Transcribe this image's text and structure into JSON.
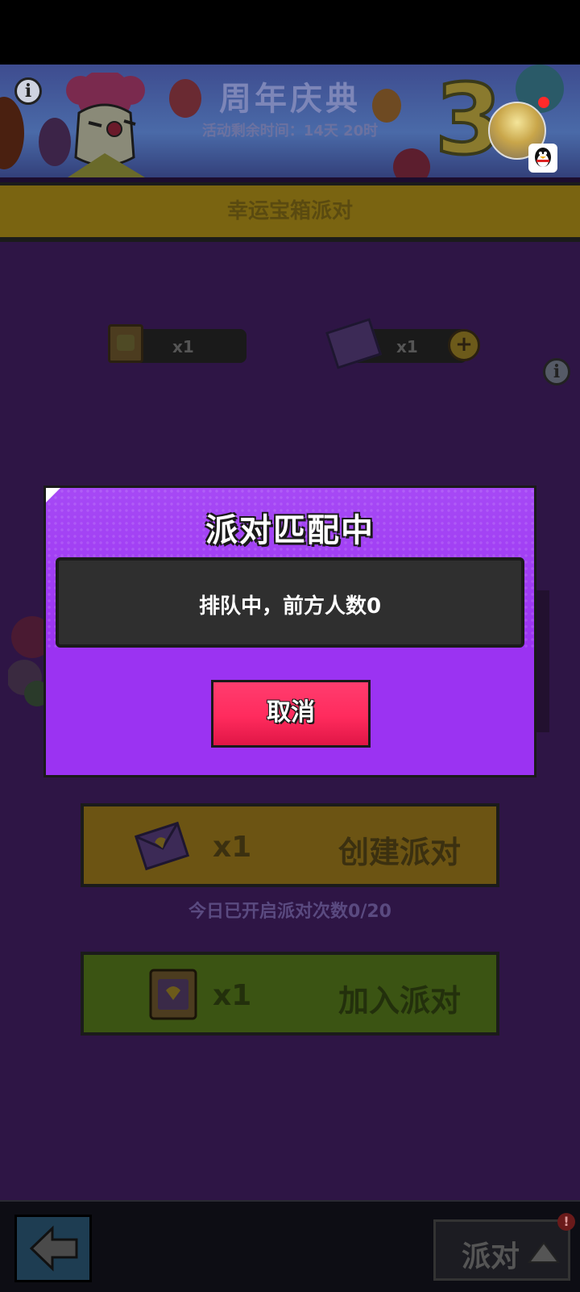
{
  "banner": {
    "title": "周年庆典",
    "subtitle": "活动剩余时间：14天 20时",
    "anniversary_number": "3"
  },
  "section": {
    "title": "幸运宝箱派对"
  },
  "resources": {
    "ticket_count": "x1",
    "envelope_count": "x1"
  },
  "modal": {
    "title": "派对匹配中",
    "message": "排队中，前方人数0",
    "cancel_label": "取消"
  },
  "actions": {
    "create_count": "x1",
    "create_label": "创建派对",
    "today_status": "今日已开启派对次数0/20",
    "join_count": "x1",
    "join_label": "加入派对"
  },
  "bottom": {
    "party_label": "派对",
    "alert": "!"
  },
  "icons": {
    "info": "info-icon",
    "back": "back-arrow-icon",
    "up": "chevron-up-icon",
    "plus": "plus-icon",
    "qq": "qq-penguin-icon"
  },
  "colors": {
    "modal_bg": "#9b33f2",
    "cancel_btn": "#ff2b5d",
    "message_box": "#2f2f2f"
  }
}
